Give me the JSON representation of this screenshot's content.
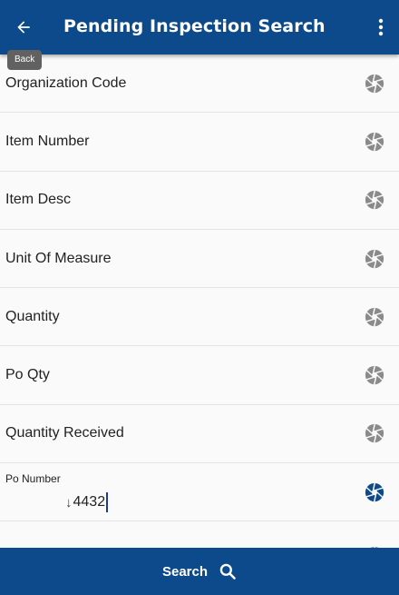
{
  "header": {
    "title": "Pending Inspection Search",
    "back_tooltip": "Back"
  },
  "fields": [
    {
      "label": "Organization Code"
    },
    {
      "label": "Item Number"
    },
    {
      "label": "Item Desc"
    },
    {
      "label": "Unit Of Measure"
    },
    {
      "label": "Quantity"
    },
    {
      "label": "Po Qty"
    },
    {
      "label": "Quantity Received"
    }
  ],
  "po_number": {
    "label": "Po Number",
    "value": "4432"
  },
  "footer": {
    "search_label": "Search"
  },
  "colors": {
    "primary": "#0d4a8c",
    "scan_icon_inactive": "#8a8a8a",
    "scan_icon_active": "#0d4a8c"
  }
}
